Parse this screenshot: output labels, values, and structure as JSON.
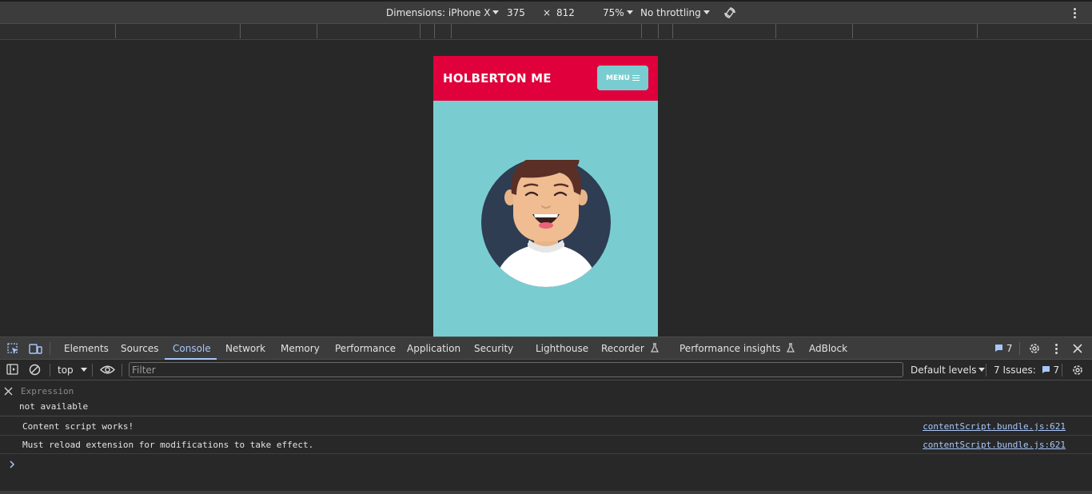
{
  "device_toolbar": {
    "dimensions_label": "Dimensions: iPhone X",
    "width": "375",
    "times": "×",
    "height": "812",
    "zoom": "75%",
    "throttling": "No throttling",
    "rotate_icon": "rotate-icon",
    "more_icon": "kebab-menu-icon"
  },
  "page": {
    "logo": "HOLBERTON ME",
    "menu_label": "MENU",
    "menu_icon": "hamburger-icon",
    "colors": {
      "header": "#e0003b",
      "background": "#79cdd1",
      "avatar_circle": "#2e3d52"
    }
  },
  "devtools": {
    "tabs": [
      {
        "label": "Elements"
      },
      {
        "label": "Sources"
      },
      {
        "label": "Console"
      },
      {
        "label": "Network"
      },
      {
        "label": "Memory"
      },
      {
        "label": "Performance"
      },
      {
        "label": "Application"
      },
      {
        "label": "Security"
      },
      {
        "label": "Lighthouse"
      },
      {
        "label": "Recorder"
      },
      {
        "label": "Performance insights"
      },
      {
        "label": "AdBlock"
      }
    ],
    "active_tab": "Console",
    "issues_badge": "7",
    "toolbar": {
      "context": "top",
      "filter_placeholder": "Filter",
      "levels": "Default levels",
      "issues_label": "7 Issues:",
      "issues_count": "7"
    },
    "live_expression": {
      "label": "Expression",
      "value": "not available"
    },
    "messages": [
      {
        "text": "Content script works!",
        "source": "contentScript.bundle.js:621"
      },
      {
        "text": "Must reload extension for modifications to take effect.",
        "source": "contentScript.bundle.js:621"
      }
    ],
    "accent_color": "#a8c7fa"
  }
}
